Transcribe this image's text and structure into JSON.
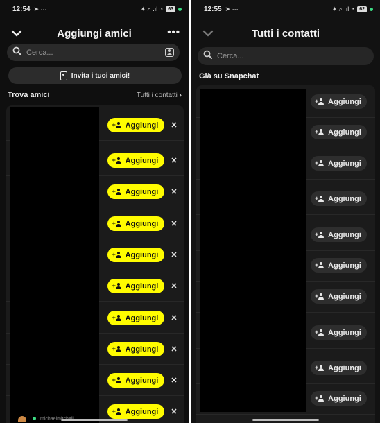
{
  "left": {
    "status": {
      "time": "12:54",
      "icons": "✶ ⌕ .ıl ◔",
      "battery": "63"
    },
    "header": {
      "title": "Aggiungi amici",
      "more": "•••"
    },
    "search": {
      "placeholder": "Cerca..."
    },
    "invite": {
      "label": "Invita i tuoi amici!"
    },
    "section": {
      "title": "Trova amici",
      "link": "Tutti i contatti"
    },
    "add_label": "Aggiungi",
    "dismiss_label": "✕",
    "row_count": 10,
    "peek_text": "michaelmitchell"
  },
  "right": {
    "status": {
      "time": "12:55",
      "icons": "✶ ⌕ .ıl ◔",
      "battery": "62"
    },
    "header": {
      "title": "Tutti i contatti"
    },
    "search": {
      "placeholder": "Cerca..."
    },
    "section": {
      "title": "Già su Snapchat"
    },
    "add_label": "Aggiungi",
    "row_count": 10
  },
  "colors": {
    "accent": "#fffc00",
    "background": "#0f0f0f",
    "card": "#1b1b1b"
  },
  "icons": [
    "chevron-down-icon",
    "more-icon",
    "search-icon",
    "contacts-icon",
    "address-book-icon",
    "add-friend-icon",
    "close-icon",
    "telegram-icon",
    "wifi-icon",
    "battery-icon"
  ]
}
